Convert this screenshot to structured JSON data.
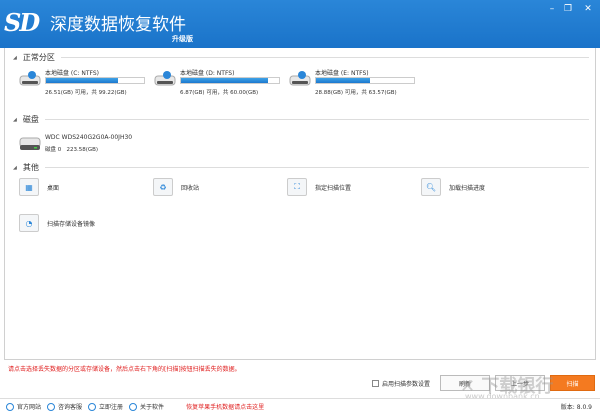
{
  "app": {
    "logo": "SD",
    "title": "深度数据恢复软件",
    "edition": "升级版"
  },
  "window": {
    "minimize": "–",
    "restore": "❐",
    "close": "✕"
  },
  "sections": {
    "partitions": "正常分区",
    "disks": "磁盘",
    "other": "其他"
  },
  "partitions": [
    {
      "name": "本地磁盘 (C: NTFS)",
      "info": "26.51(GB) 可用，共 99.22(GB)",
      "used_fraction": 0.733
    },
    {
      "name": "本地磁盘 (D: NTFS)",
      "info": "6.87(GB) 可用，共 60.00(GB)",
      "used_fraction": 0.886
    },
    {
      "name": "本地磁盘 (E: NTFS)",
      "info": "28.88(GB) 可用，共 63.57(GB)",
      "used_fraction": 0.546
    }
  ],
  "disk": {
    "model": "WDC WDS240G2G0A-00JH30",
    "label": "磁盘 0",
    "size": "223.58(GB)"
  },
  "other": [
    {
      "label": "桌面",
      "icon": "desktop-icon"
    },
    {
      "label": "回收站",
      "icon": "recycle-bin-icon"
    },
    {
      "label": "指定扫描位置",
      "icon": "folder-scan-icon"
    },
    {
      "label": "加载扫描进度",
      "icon": "load-progress-icon"
    },
    {
      "label": "扫描存储设备镜像",
      "icon": "disk-image-icon"
    }
  ],
  "hint": "请点击选择丢失数据的分区或存储设备，然后点击右下角的[扫描]按钮扫描丢失的数据。",
  "options": {
    "advanced": "启用扫描参数设置"
  },
  "buttons": {
    "refresh": "刷新",
    "back": "上一步",
    "scan": "扫描"
  },
  "footer": {
    "links": [
      "官方网站",
      "咨询客服",
      "立即注册",
      "关于软件"
    ],
    "promo": "恢复苹果手机数据请点击这里",
    "version": "版本: 8.0.9"
  },
  "watermark": {
    "text": "下载银行",
    "url": "www.downbank.cn"
  },
  "colors": {
    "titlebar": "#1a73c9",
    "scan_button": "#f47a20",
    "hint": "#e02020"
  }
}
